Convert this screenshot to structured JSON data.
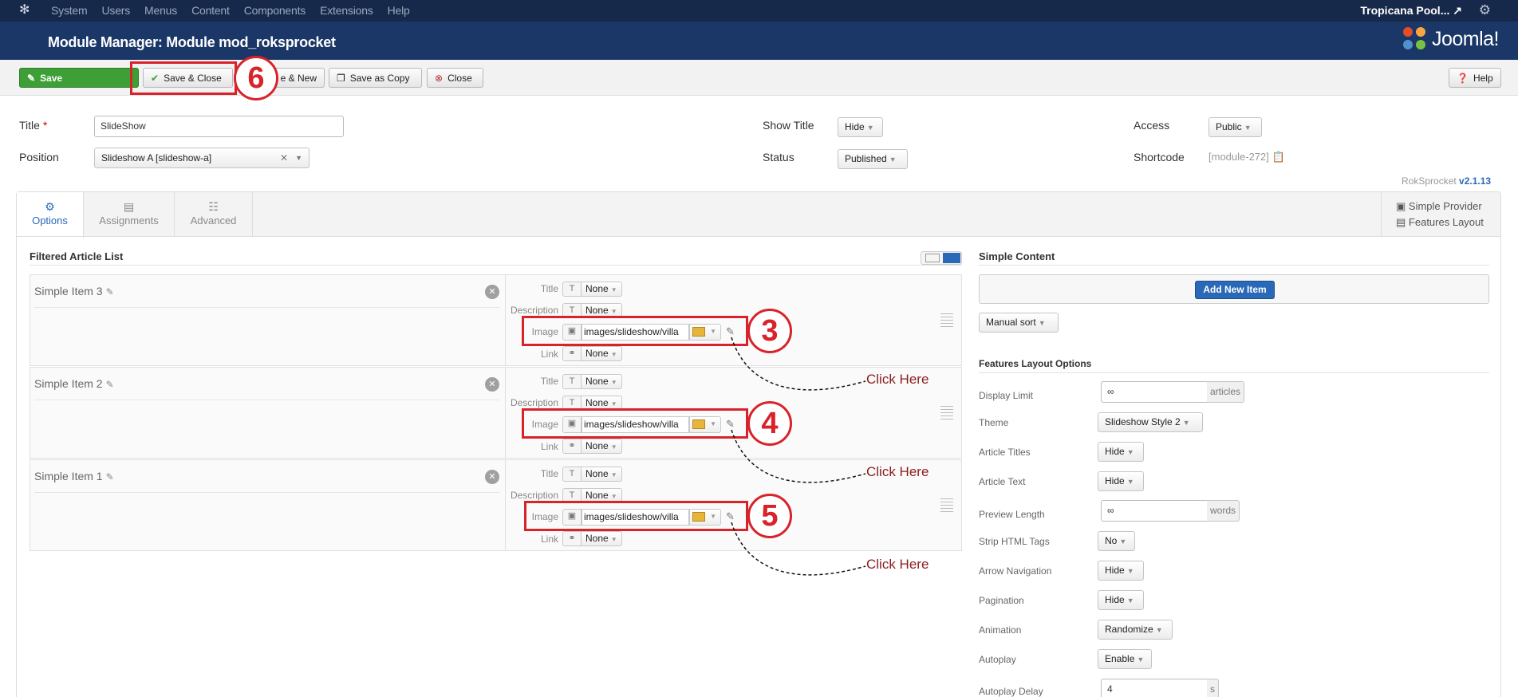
{
  "topnav": {
    "menu": [
      "System",
      "Users",
      "Menus",
      "Content",
      "Components",
      "Extensions",
      "Help"
    ],
    "site_name": "Tropicana Pool...",
    "icons": [
      "joomla-icon",
      "external-link-icon",
      "gear-icon"
    ]
  },
  "header": {
    "title": "Module Manager: Module mod_roksprocket",
    "brand": "Joomla!"
  },
  "toolbar": {
    "save": "Save",
    "save_close": "Save & Close",
    "save_new": "e & New",
    "save_copy": "Save as Copy",
    "close": "Close",
    "help": "Help"
  },
  "form": {
    "title_label": "Title",
    "title_required": "*",
    "title_value": "SlideShow",
    "position_label": "Position",
    "position_value": "Slideshow A [slideshow-a]",
    "show_title_label": "Show Title",
    "show_title_value": "Hide",
    "status_label": "Status",
    "status_value": "Published",
    "access_label": "Access",
    "access_value": "Public",
    "shortcode_label": "Shortcode",
    "shortcode_value": "[module-272]",
    "version_prefix": "RokSprocket",
    "version": "v2.1.13"
  },
  "tabs": [
    "Options",
    "Assignments",
    "Advanced"
  ],
  "provider": {
    "provider_label": "Simple Provider",
    "layout_label": "Features Layout"
  },
  "article_list": {
    "heading": "Filtered Article List",
    "field_labels": {
      "title": "Title",
      "description": "Description",
      "image": "Image",
      "link": "Link"
    },
    "none": "None",
    "items": [
      {
        "name": "Simple Item 3",
        "image_path": "images/slideshow/villa"
      },
      {
        "name": "Simple Item 2",
        "image_path": "images/slideshow/villa"
      },
      {
        "name": "Simple Item 1",
        "image_path": "images/slideshow/villa"
      }
    ]
  },
  "annotations": {
    "badges": [
      "6",
      "3",
      "4",
      "5"
    ],
    "click_here": "Click Here",
    "color": "#d8232a"
  },
  "simple_content": {
    "heading": "Simple Content",
    "add_button": "Add New Item",
    "sort": "Manual sort"
  },
  "features": {
    "heading": "Features Layout Options",
    "display_limit_label": "Display Limit",
    "display_limit_value": "∞",
    "display_limit_unit": "articles",
    "theme_label": "Theme",
    "theme_value": "Slideshow Style 2",
    "article_titles_label": "Article Titles",
    "article_titles_value": "Hide",
    "article_text_label": "Article Text",
    "article_text_value": "Hide",
    "preview_length_label": "Preview Length",
    "preview_length_value": "∞",
    "preview_length_unit": "words",
    "strip_html_label": "Strip HTML Tags",
    "strip_html_value": "No",
    "arrow_nav_label": "Arrow Navigation",
    "arrow_nav_value": "Hide",
    "pagination_label": "Pagination",
    "pagination_value": "Hide",
    "animation_label": "Animation",
    "animation_value": "Randomize",
    "autoplay_label": "Autoplay",
    "autoplay_value": "Enable",
    "autoplay_delay_label": "Autoplay Delay",
    "autoplay_delay_value": "4",
    "autoplay_delay_unit": "s"
  },
  "colors": {
    "topnav": "#17294a",
    "header": "#1a3767",
    "save_green": "#3d9f36",
    "add_blue": "#2a69b8"
  }
}
